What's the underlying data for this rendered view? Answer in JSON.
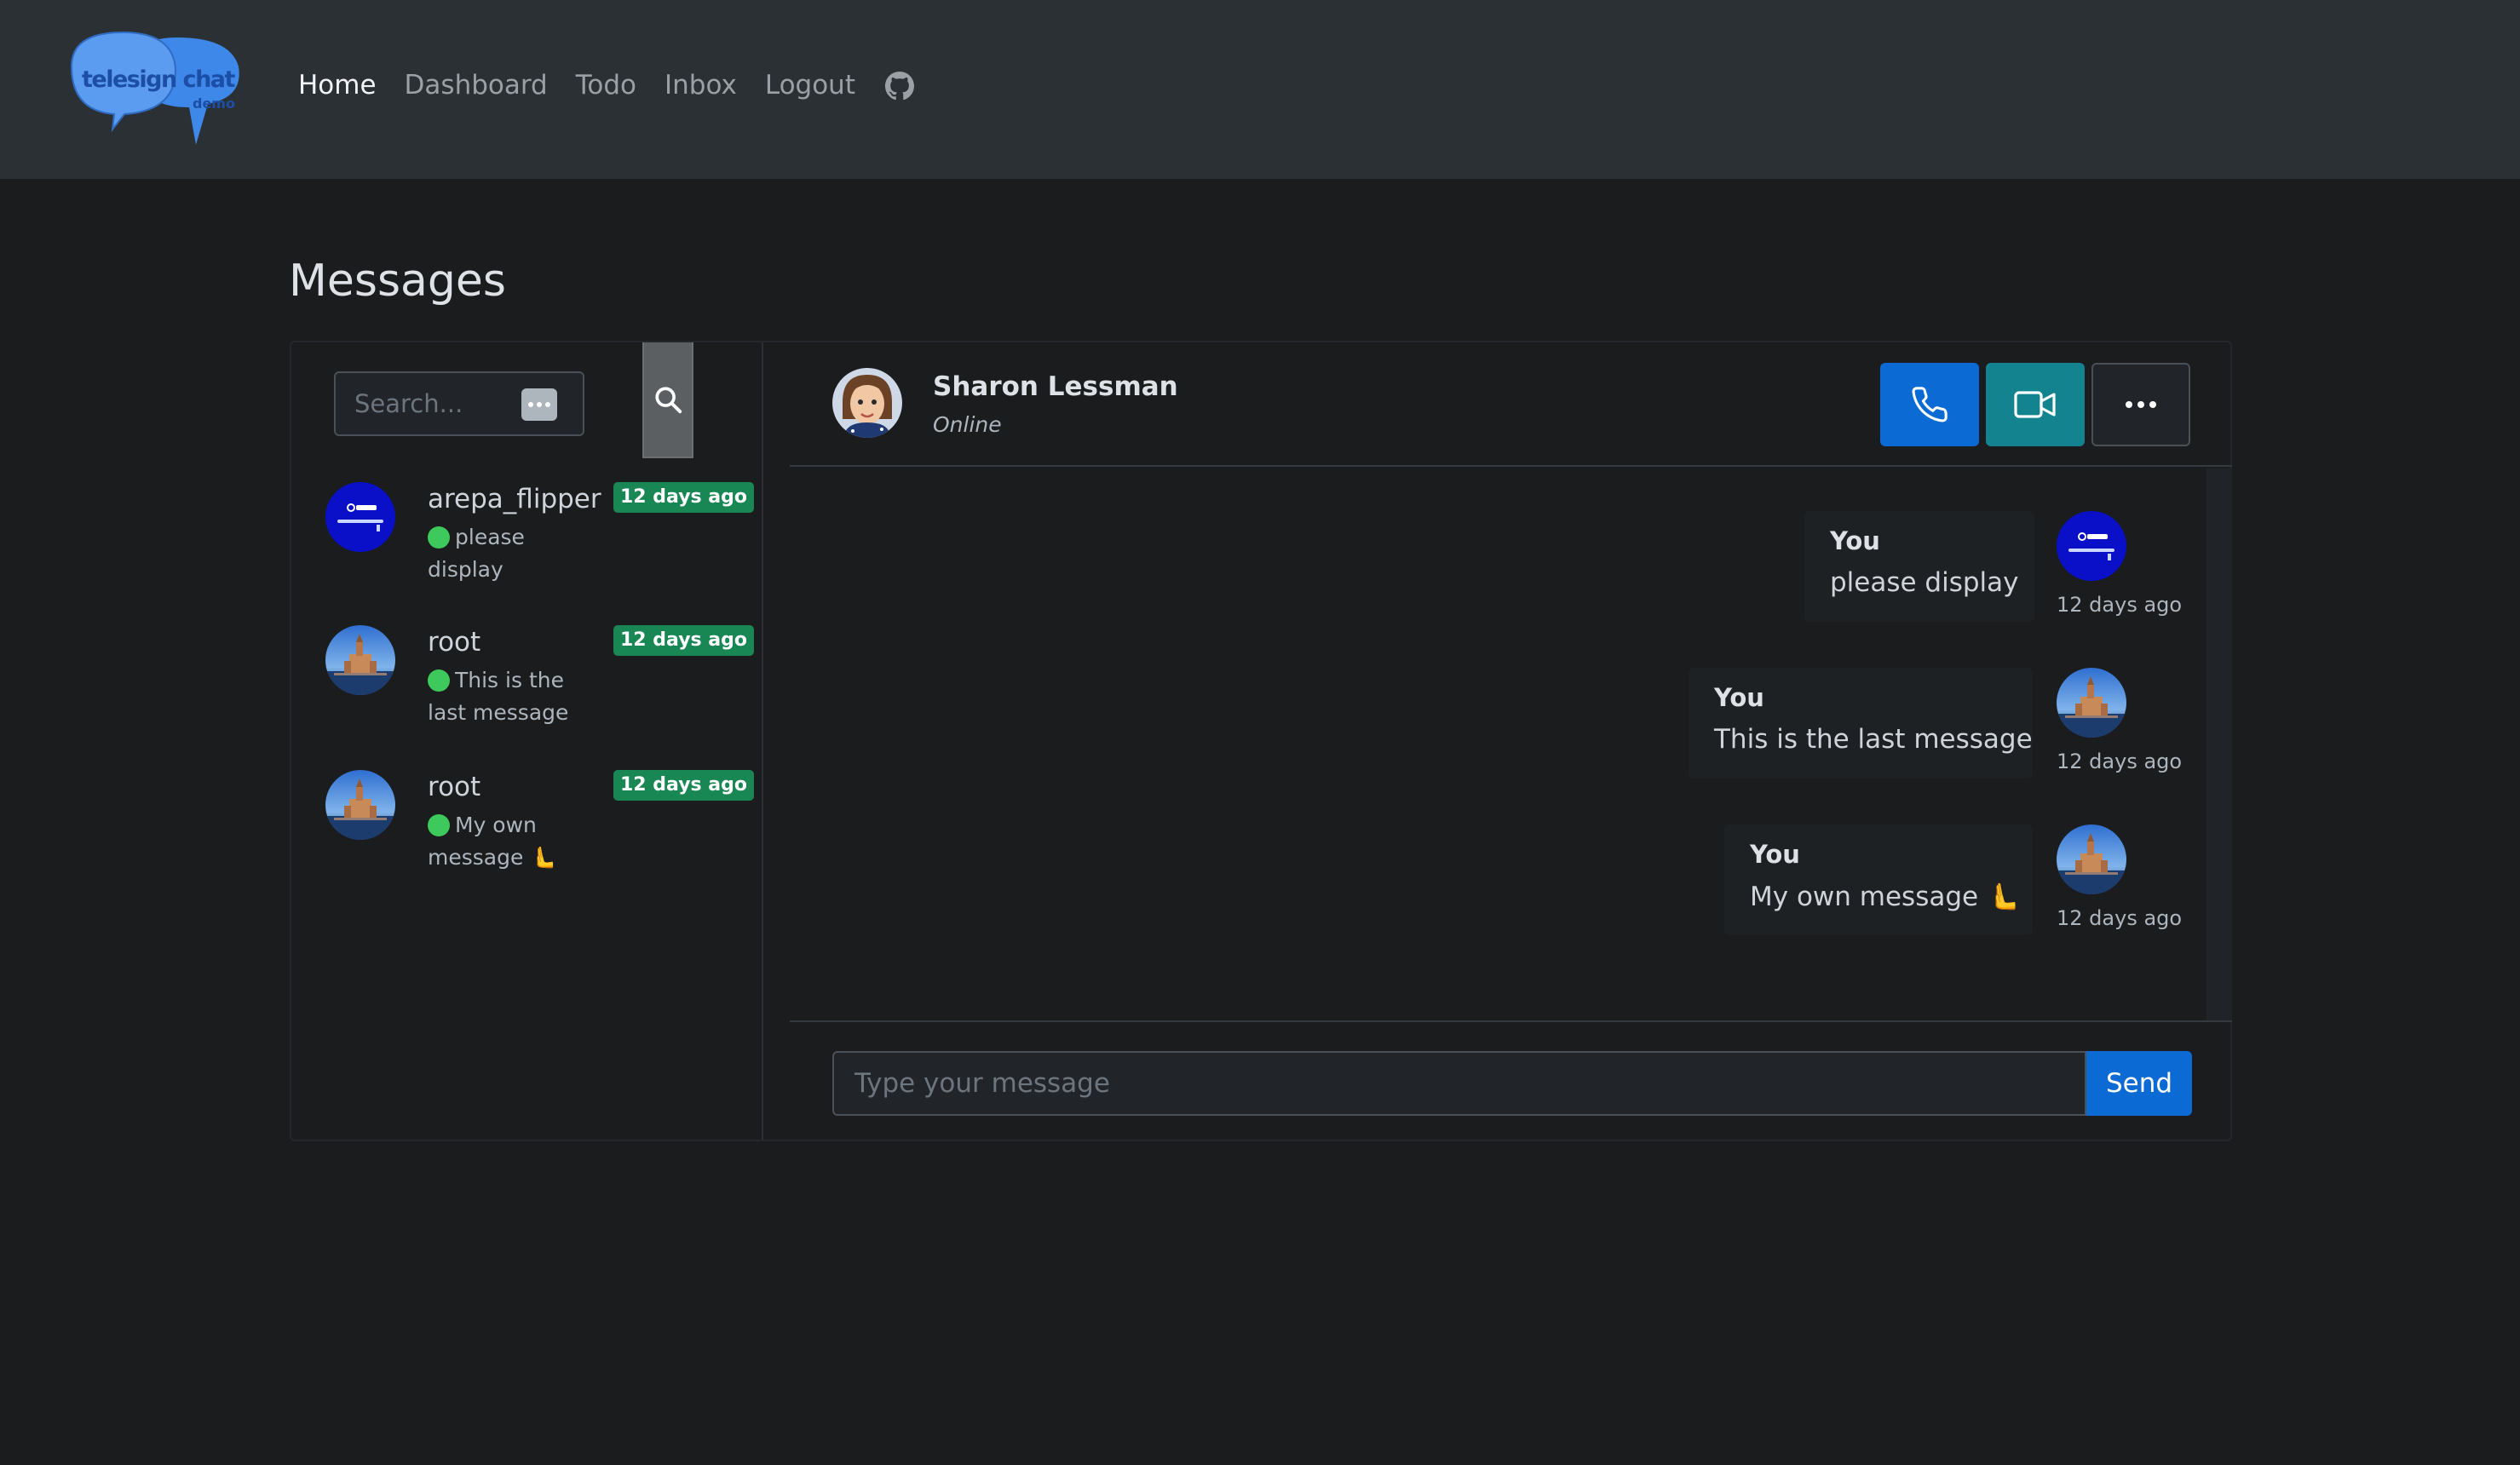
{
  "brand": {
    "logo_text": "telesign chat",
    "logo_sub": "demo"
  },
  "nav": {
    "items": [
      {
        "label": "Home",
        "active": true
      },
      {
        "label": "Dashboard",
        "active": false
      },
      {
        "label": "Todo",
        "active": false
      },
      {
        "label": "Inbox",
        "active": false
      },
      {
        "label": "Logout",
        "active": false
      }
    ],
    "github_icon": "github-icon"
  },
  "page": {
    "title": "Messages"
  },
  "sidebar": {
    "search": {
      "placeholder": "Search...",
      "icon": "search-icon"
    },
    "conversations": [
      {
        "name": "arepa_flipper",
        "time": "12 days ago",
        "preview": "please display",
        "avatar": "telesign-logo-avatar"
      },
      {
        "name": "root",
        "time": "12 days ago",
        "preview": "This is the last message",
        "avatar": "castle-avatar"
      },
      {
        "name": "root",
        "time": "12 days ago",
        "preview": "My own message 🫷",
        "avatar": "castle-avatar"
      }
    ]
  },
  "chat": {
    "contact": {
      "name": "Sharon Lessman",
      "status": "Online"
    },
    "actions": [
      {
        "icon": "phone-icon",
        "color": "#0b6ad3"
      },
      {
        "icon": "video-icon",
        "color": "#13838f"
      },
      {
        "icon": "more-icon",
        "color": "#212529"
      }
    ],
    "messages": [
      {
        "author": "You",
        "text": "please display",
        "time": "12 days ago",
        "avatar": "telesign-logo-avatar"
      },
      {
        "author": "You",
        "text": "This is the last message",
        "time": "12 days ago",
        "avatar": "castle-avatar"
      },
      {
        "author": "You",
        "text": "My own message 🫷",
        "time": "12 days ago",
        "avatar": "castle-avatar"
      }
    ],
    "composer": {
      "placeholder": "Type your message",
      "send_label": "Send"
    }
  },
  "colors": {
    "badge": "#198754",
    "primary": "#0b6ad3",
    "info": "#13838f",
    "online": "#3ec95c"
  }
}
